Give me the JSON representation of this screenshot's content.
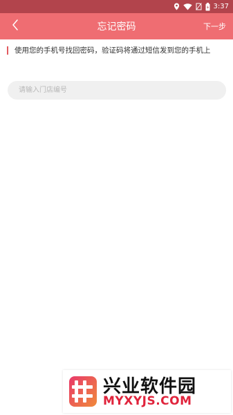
{
  "status_bar": {
    "time": "3:37",
    "icons": [
      "location-icon",
      "wifi-icon",
      "no-sim-icon",
      "battery-icon"
    ],
    "background": "#b2444c"
  },
  "app_bar": {
    "title": "忘记密码",
    "next_label": "下一步",
    "back_icon": "chevron-left-icon",
    "background": "#ef6d72"
  },
  "hint": {
    "text": "使用您的手机号找回密码，验证码将通过短信发到您的手机上",
    "accent": "#e25a60"
  },
  "form": {
    "store_id_placeholder": "请输入门店编号",
    "store_id_value": ""
  },
  "watermark": {
    "name": "兴业软件园",
    "url": "MYXYJS.COM",
    "url_color": "#e0243c"
  }
}
